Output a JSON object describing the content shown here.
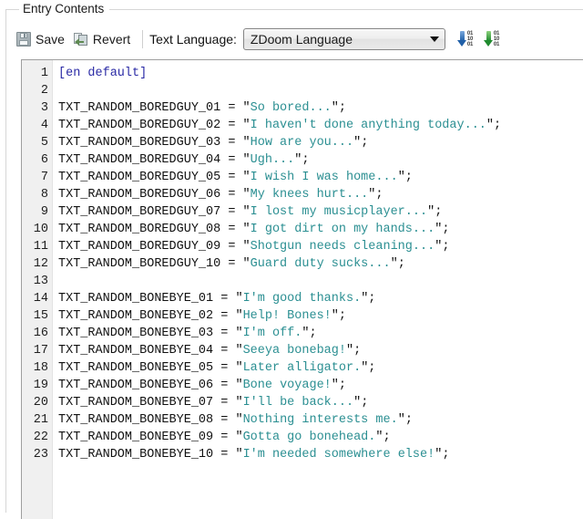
{
  "groupbox": {
    "legend": "Entry Contents"
  },
  "toolbar": {
    "save_label": "Save",
    "revert_label": "Revert",
    "text_language_label": "Text Language:",
    "language_combo": {
      "value": "ZDoom Language",
      "options": [
        "ZDoom Language"
      ]
    },
    "compile_icon_1_name": "compile-blue-icon",
    "compile_icon_2_name": "compile-green-icon",
    "icon_bits": "01\n10\n01"
  },
  "editor": {
    "line_numbers": [
      "1",
      "2",
      "3",
      "4",
      "5",
      "6",
      "7",
      "8",
      "9",
      "10",
      "11",
      "12",
      "13",
      "14",
      "15",
      "16",
      "17",
      "18",
      "19",
      "20",
      "21",
      "22",
      "23"
    ],
    "lines": [
      {
        "n": "1",
        "type": "section",
        "text": "[en default]"
      },
      {
        "n": "2",
        "type": "blank",
        "text": ""
      },
      {
        "n": "3",
        "type": "assign",
        "ident": "TXT_RANDOM_BOREDGUY_01",
        "value": "So bored..."
      },
      {
        "n": "4",
        "type": "assign",
        "ident": "TXT_RANDOM_BOREDGUY_02",
        "value": "I haven't done anything today..."
      },
      {
        "n": "5",
        "type": "assign",
        "ident": "TXT_RANDOM_BOREDGUY_03",
        "value": "How are you..."
      },
      {
        "n": "6",
        "type": "assign",
        "ident": "TXT_RANDOM_BOREDGUY_04",
        "value": "Ugh..."
      },
      {
        "n": "7",
        "type": "assign",
        "ident": "TXT_RANDOM_BOREDGUY_05",
        "value": "I wish I was home..."
      },
      {
        "n": "8",
        "type": "assign",
        "ident": "TXT_RANDOM_BOREDGUY_06",
        "value": "My knees hurt..."
      },
      {
        "n": "9",
        "type": "assign",
        "ident": "TXT_RANDOM_BOREDGUY_07",
        "value": "I lost my musicplayer..."
      },
      {
        "n": "10",
        "type": "assign",
        "ident": "TXT_RANDOM_BOREDGUY_08",
        "value": "I got dirt on my hands..."
      },
      {
        "n": "11",
        "type": "assign",
        "ident": "TXT_RANDOM_BOREDGUY_09",
        "value": "Shotgun needs cleaning..."
      },
      {
        "n": "12",
        "type": "assign",
        "ident": "TXT_RANDOM_BOREDGUY_10",
        "value": "Guard duty sucks..."
      },
      {
        "n": "13",
        "type": "blank",
        "text": ""
      },
      {
        "n": "14",
        "type": "assign",
        "ident": "TXT_RANDOM_BONEBYE_01",
        "value": "I'm good thanks."
      },
      {
        "n": "15",
        "type": "assign",
        "ident": "TXT_RANDOM_BONEBYE_02",
        "value": "Help! Bones!"
      },
      {
        "n": "16",
        "type": "assign",
        "ident": "TXT_RANDOM_BONEBYE_03",
        "value": "I'm off."
      },
      {
        "n": "17",
        "type": "assign",
        "ident": "TXT_RANDOM_BONEBYE_04",
        "value": "Seeya bonebag!"
      },
      {
        "n": "18",
        "type": "assign",
        "ident": "TXT_RANDOM_BONEBYE_05",
        "value": "Later alligator."
      },
      {
        "n": "19",
        "type": "assign",
        "ident": "TXT_RANDOM_BONEBYE_06",
        "value": "Bone voyage!"
      },
      {
        "n": "20",
        "type": "assign",
        "ident": "TXT_RANDOM_BONEBYE_07",
        "value": "I'll be back..."
      },
      {
        "n": "21",
        "type": "assign",
        "ident": "TXT_RANDOM_BONEBYE_08",
        "value": "Nothing interests me."
      },
      {
        "n": "22",
        "type": "assign",
        "ident": "TXT_RANDOM_BONEBYE_09",
        "value": "Gotta go bonehead."
      },
      {
        "n": "23",
        "type": "assign",
        "ident": "TXT_RANDOM_BONEBYE_10",
        "value": "I'm needed somewhere else!"
      }
    ],
    "operator": "=",
    "terminator": ";",
    "quote": "\""
  },
  "colors": {
    "string": "#2b8f92",
    "section": "#2a2aa5",
    "identifier": "#111111",
    "gutter_bg": "#f0f0f0",
    "editor_bg": "#ffffff"
  }
}
